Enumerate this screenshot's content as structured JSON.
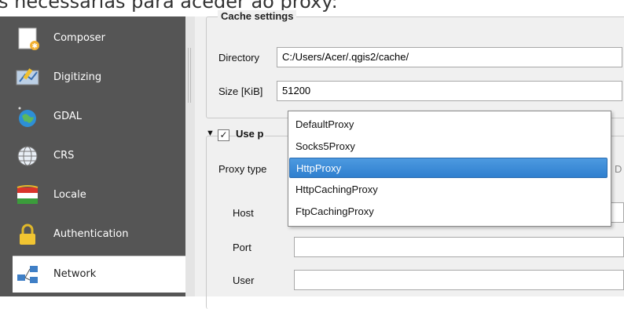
{
  "page_caption": "s necessárias para aceder ao proxy:",
  "sidebar": {
    "items": [
      {
        "label": "Composer",
        "icon": "composer-icon"
      },
      {
        "label": "Digitizing",
        "icon": "digitizing-icon"
      },
      {
        "label": "GDAL",
        "icon": "gdal-icon"
      },
      {
        "label": "CRS",
        "icon": "crs-icon"
      },
      {
        "label": "Locale",
        "icon": "locale-icon"
      },
      {
        "label": "Authentication",
        "icon": "lock-icon"
      },
      {
        "label": "Network",
        "icon": "network-icon"
      }
    ],
    "active": "Network"
  },
  "cache": {
    "title": "Cache settings",
    "directory_label": "Directory",
    "directory_value": "C:/Users/Acer/.qgis2/cache/",
    "size_label": "Size [KiB]",
    "size_value": "51200"
  },
  "proxy": {
    "use_label": "Use p",
    "checked_mark": "✓",
    "type_label": "Proxy type",
    "host_label": "Host",
    "port_label": "Port",
    "user_label": "User",
    "behind_fragment": "D",
    "options": [
      "DefaultProxy",
      "Socks5Proxy",
      "HttpProxy",
      "HttpCachingProxy",
      "FtpCachingProxy"
    ],
    "selected": "HttpProxy"
  },
  "colors": {
    "sidebar_bg": "#555555",
    "selection": "#3a8bd8"
  }
}
